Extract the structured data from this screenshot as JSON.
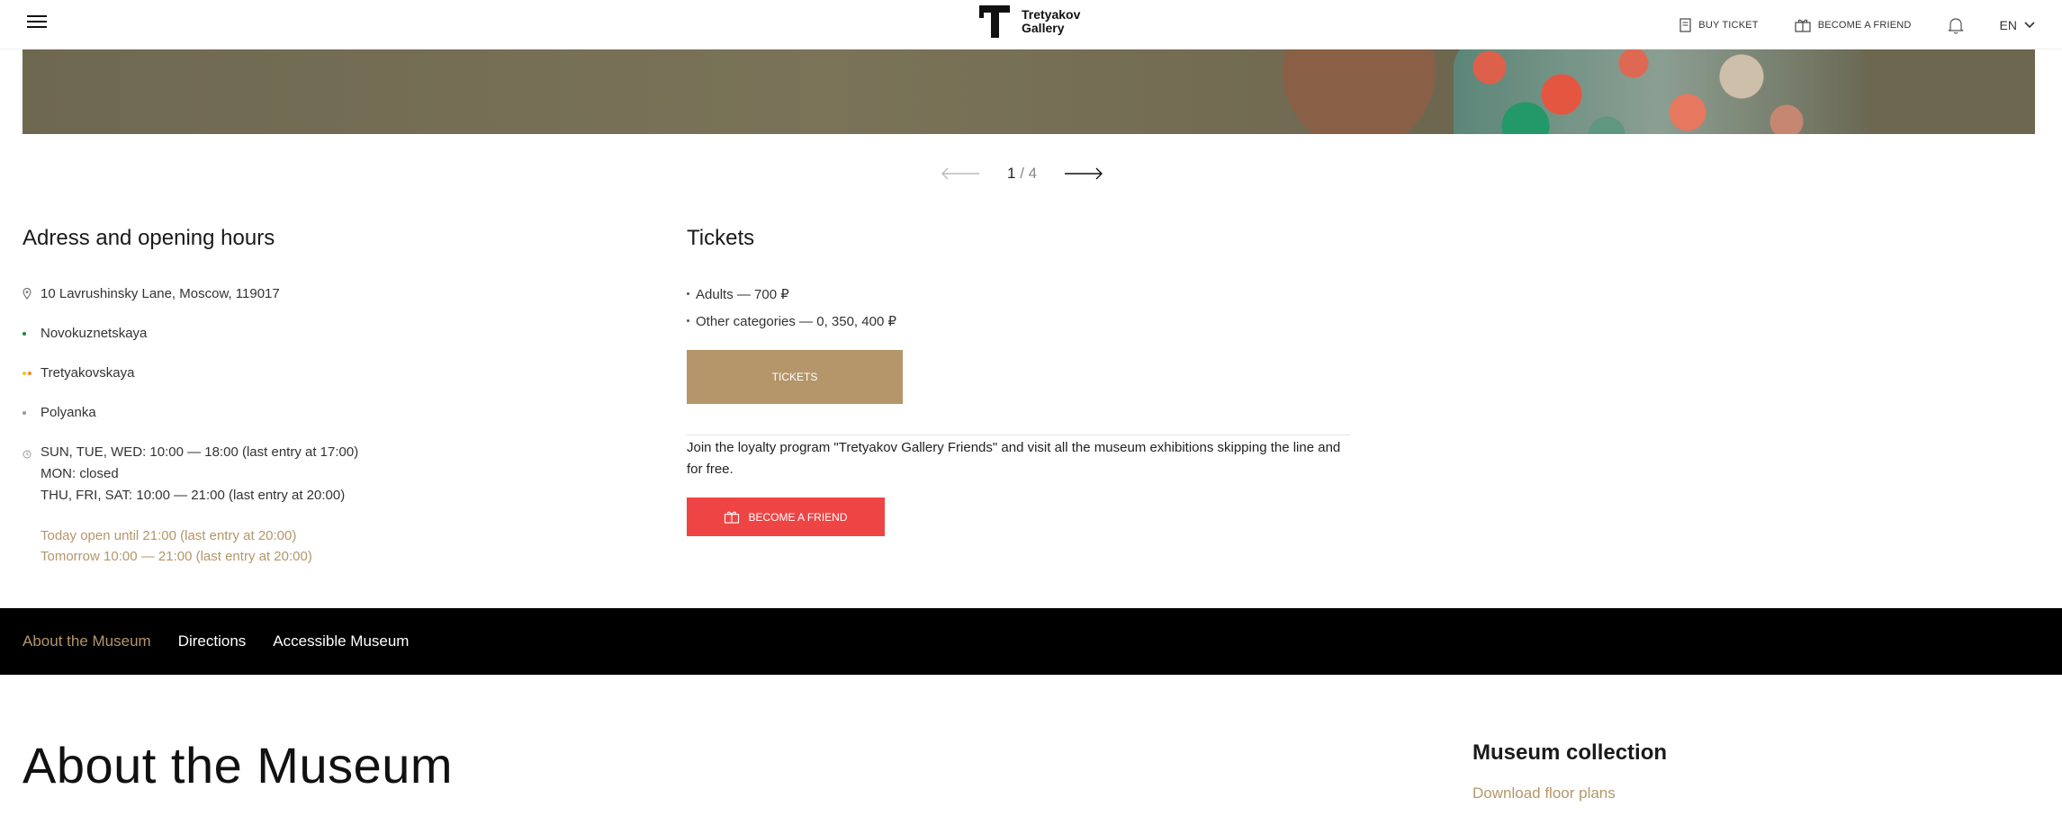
{
  "header": {
    "logo_line1": "Tretyakov",
    "logo_line2": "Gallery",
    "buy_ticket": "BUY TICKET",
    "become_friend": "BECOME A FRIEND",
    "language": "EN"
  },
  "pager": {
    "current": "1",
    "separator": "/",
    "total": "4"
  },
  "address": {
    "title": "Adress and opening hours",
    "street": "10 Lavrushinsky Lane, Moscow, 119017",
    "metro": [
      {
        "name": "Novokuznetskaya",
        "color": "#1e8a3c"
      },
      {
        "name": "Tretyakovskaya",
        "color": "#f5c518"
      },
      {
        "name": "Polyanka",
        "color": "#9a9a9a"
      }
    ],
    "hours": [
      "SUN, TUE, WED: 10:00 — 18:00 (last entry at 17:00)",
      "MON: closed",
      "THU, FRI, SAT: 10:00 — 21:00 (last entry at 20:00)"
    ],
    "today": "Today open until 21:00 (last entry at 20:00)",
    "tomorrow": "Tomorrow 10:00 — 21:00 (last entry at 20:00)"
  },
  "tickets": {
    "title": "Tickets",
    "prices": [
      "Adults — 700 ₽",
      "Other categories — 0, 350, 400 ₽"
    ],
    "button": "TICKETS",
    "loyalty_text": "Join the loyalty program \"Tretyakov Gallery Friends\" and visit all the museum exhibitions skipping the line and for free.",
    "friend_button": "BECOME A FRIEND"
  },
  "subnav": {
    "items": [
      "About the Museum",
      "Directions",
      "Accessible Museum"
    ]
  },
  "about": {
    "title": "About the Museum",
    "collection_title": "Museum collection",
    "floor_plans": "Download floor plans"
  },
  "colors": {
    "accent_gold": "#b4966a",
    "accent_red": "#ef4444",
    "nav_bg": "#000000"
  }
}
